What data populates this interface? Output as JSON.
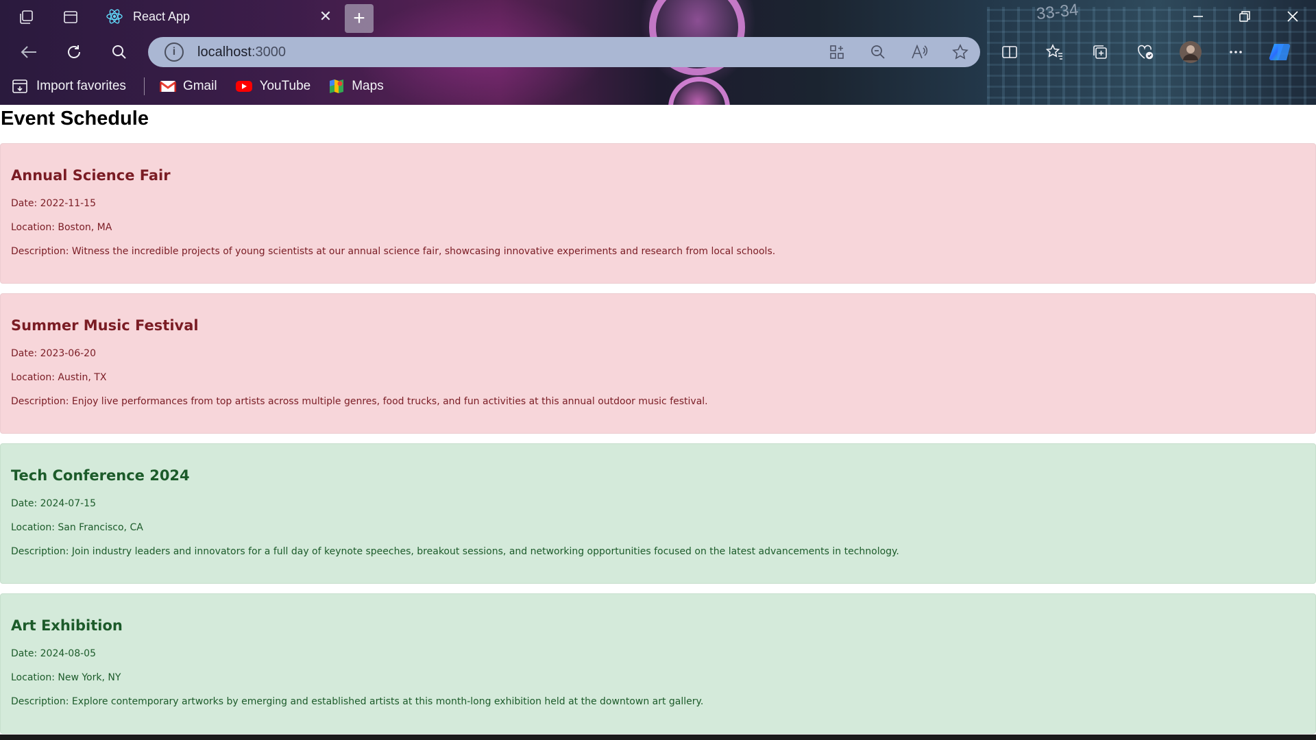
{
  "browser": {
    "tab_title": "React App",
    "tab_close_glyph": "✕",
    "new_tab_glyph": "+",
    "url_host": "localhost",
    "url_port": ":3000",
    "info_glyph": "i",
    "bookmarks": [
      {
        "label": "Import favorites",
        "icon": "import-favorites-icon"
      },
      {
        "label": "Gmail",
        "icon": "gmail-icon"
      },
      {
        "label": "YouTube",
        "icon": "youtube-icon"
      },
      {
        "label": "Maps",
        "icon": "maps-icon"
      }
    ],
    "wallpaper_text": "33-34"
  },
  "page": {
    "title": "Event Schedule",
    "events": [
      {
        "name": "Annual Science Fair",
        "date": "Date: 2022-11-15",
        "location": "Location: Boston, MA",
        "description": "Description: Witness the incredible projects of young scientists at our annual science fair, showcasing innovative experiments and research from local schools.",
        "status": "past"
      },
      {
        "name": "Summer Music Festival",
        "date": "Date: 2023-06-20",
        "location": "Location: Austin, TX",
        "description": "Description: Enjoy live performances from top artists across multiple genres, food trucks, and fun activities at this annual outdoor music festival.",
        "status": "past"
      },
      {
        "name": "Tech Conference 2024",
        "date": "Date: 2024-07-15",
        "location": "Location: San Francisco, CA",
        "description": "Description: Join industry leaders and innovators for a full day of keynote speeches, breakout sessions, and networking opportunities focused on the latest advancements in technology.",
        "status": "upcoming"
      },
      {
        "name": "Art Exhibition",
        "date": "Date: 2024-08-05",
        "location": "Location: New York, NY",
        "description": "Description: Explore contemporary artworks by emerging and established artists at this month-long exhibition held at the downtown art gallery.",
        "status": "upcoming"
      }
    ]
  },
  "colors": {
    "past_bg": "#f7d6da",
    "past_text": "#7a1c24",
    "upcoming_bg": "#d4eada",
    "upcoming_text": "#1c5b2a",
    "address_bar": "#aab7d3"
  }
}
